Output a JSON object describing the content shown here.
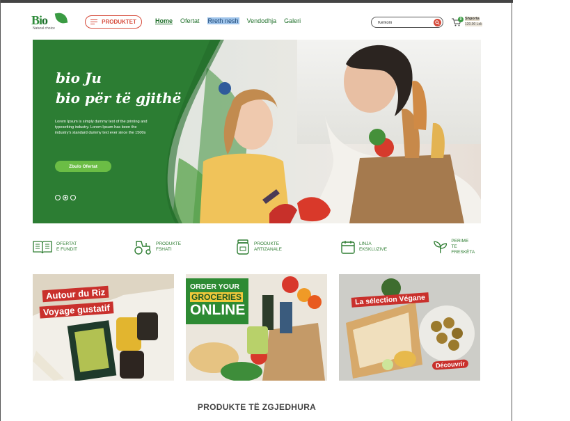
{
  "brand": {
    "name_left": "Bi",
    "name_o": "o",
    "tagline": "Natural choice"
  },
  "header": {
    "products_button": "PRODUKTET",
    "nav": [
      {
        "label": "Home",
        "state": "active"
      },
      {
        "label": "Ofertat",
        "state": ""
      },
      {
        "label": "Rreth nesh",
        "state": "selected"
      },
      {
        "label": "Vendodhja",
        "state": ""
      },
      {
        "label": "Galeri",
        "state": ""
      }
    ],
    "search": {
      "value": "Kerkoni",
      "icon": "search-icon"
    },
    "cart": {
      "label": "Shporta",
      "amount": "120.00 Lek",
      "count": "0",
      "icon": "cart-icon"
    }
  },
  "hero": {
    "title_line1": "bio Ju",
    "title_line2": "bio për të gjithë",
    "text": "Lorem Ipsum is simply dummy text of the printing and typesetting industry. Lorem Ipsum has been the industry's standard dummy text ever since the 1500s",
    "cta": "Zbulo Ofertat",
    "slides": 3,
    "active_slide": 2
  },
  "features": [
    {
      "line1": "OFERTAT",
      "line2": "E FUNDIT",
      "icon": "book-icon"
    },
    {
      "line1": "PRODUKTE",
      "line2": "FSHATI",
      "icon": "tractor-icon"
    },
    {
      "line1": "PRODUKTE",
      "line2": "ARTIZANALE",
      "icon": "jar-icon"
    },
    {
      "line1": "LINJA",
      "line2": "EKSKLUZIVE",
      "icon": "calendar-icon"
    },
    {
      "line1": "PERIME",
      "line2": "TE FRESKËTA",
      "icon": "sprout-icon"
    }
  ],
  "tiles": [
    {
      "line1": "Autour du Riz",
      "line2": "Voyage gustatif"
    },
    {
      "line1": "ORDER YOUR",
      "line2": "GROCERIES",
      "line3": "ONLINE"
    },
    {
      "line1": "La sélection Végane",
      "badge": "Découvrir"
    }
  ],
  "section": {
    "title": "PRODUKTE TË ZGJEDHURA"
  },
  "colors": {
    "green": "#2c7d33",
    "accent_red": "#d64a3a",
    "cta_green": "#6bbd45"
  }
}
